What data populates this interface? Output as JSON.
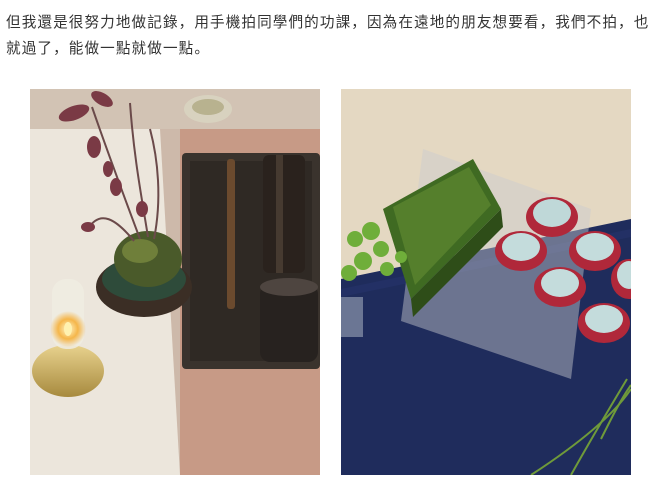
{
  "article": {
    "paragraph": "但我還是很努力地做記錄，用手機拍同學們的功課，因為在遠地的朋友想要看，我們不拍，也就過了，能做一點就做一點。"
  },
  "photos": {
    "left": {
      "subject": "kokedama-plant-oil-lamp-tea-tray",
      "palette": [
        "#ece6dc",
        "#b48c78",
        "#3a332d",
        "#4a5a2a"
      ]
    },
    "right": {
      "subject": "moss-box-red-cups-on-navy-cloth",
      "palette": [
        "#e4d8c2",
        "#1f2c5c",
        "#3f6a22",
        "#b0283a"
      ]
    }
  }
}
